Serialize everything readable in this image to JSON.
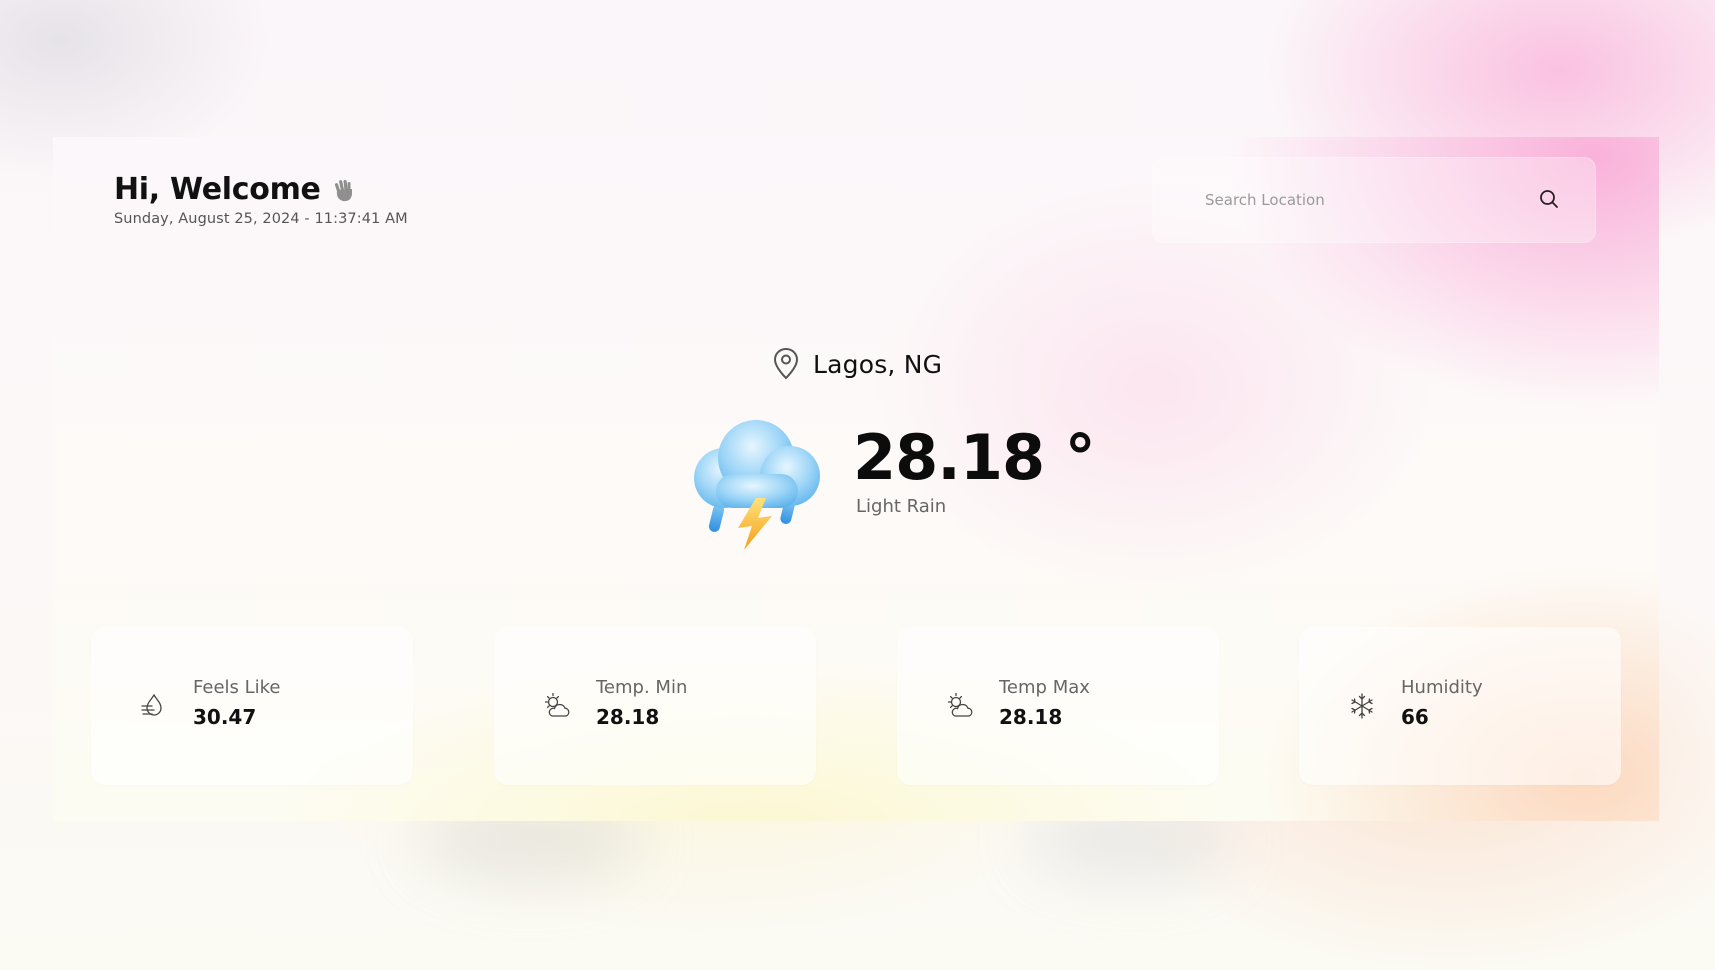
{
  "header": {
    "greeting": "Hi, Welcome",
    "greeting_icon": "waving-hand-icon",
    "datetime": "Sunday, August 25, 2024 - 11:37:41 AM"
  },
  "search": {
    "placeholder": "Search Location",
    "value": "",
    "icon": "search-icon"
  },
  "location": {
    "icon": "map-pin-icon",
    "name": "Lagos, NG"
  },
  "current": {
    "icon": "thunderstorm-cloud-icon",
    "temperature": "28.18 °",
    "description": "Light Rain"
  },
  "stats": [
    {
      "icon": "feels-like-icon",
      "label": "Feels Like",
      "value": "30.47"
    },
    {
      "icon": "partly-sunny-icon",
      "label": "Temp. Min",
      "value": "28.18"
    },
    {
      "icon": "partly-sunny-icon",
      "label": "Temp Max",
      "value": "28.18"
    },
    {
      "icon": "humidity-icon",
      "label": "Humidity",
      "value": "66"
    }
  ],
  "colors": {
    "accent_pink": "#f7a8d4",
    "accent_peach": "#fbcdaf",
    "text_primary": "#111111",
    "text_secondary": "#666666",
    "storm_cloud": "#7cc4f2",
    "lightning": "#f7b733"
  }
}
